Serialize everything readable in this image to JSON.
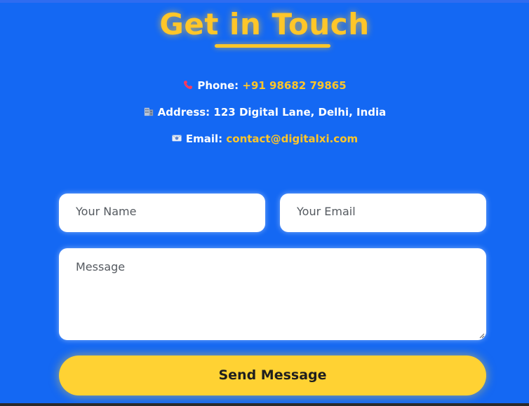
{
  "header": {
    "title": "Get in Touch"
  },
  "contact_info": {
    "phone": {
      "icon": "phone-icon",
      "label": "Phone:",
      "value": "+91 98682 79865"
    },
    "address": {
      "icon": "office-building-icon",
      "label": "Address:",
      "value": "123 Digital Lane, Delhi, India"
    },
    "email": {
      "icon": "envelope-icon",
      "label": "Email:",
      "value": "contact@digitalxi.com"
    }
  },
  "form": {
    "name_placeholder": "Your Name",
    "email_placeholder": "Your Email",
    "message_placeholder": "Message",
    "submit_label": "Send Message"
  },
  "colors": {
    "background": "#1468f3",
    "accent": "#ffc629",
    "button": "#ffd233"
  }
}
